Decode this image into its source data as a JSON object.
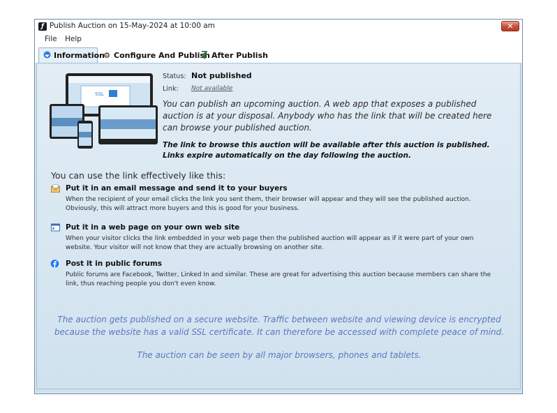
{
  "window": {
    "title": "Publish Auction on 15-May-2024 at 10:00 am",
    "close_glyph": "✕"
  },
  "menu": {
    "items": [
      "File",
      "Help"
    ]
  },
  "tabs": [
    {
      "label": "Information",
      "icon": "info-icon",
      "active": true
    },
    {
      "label": "Configure And Publish",
      "icon": "gear-icon",
      "active": false
    },
    {
      "label": "After Publish",
      "icon": "upload-arrow-icon",
      "active": false
    }
  ],
  "status": {
    "status_label": "Status:",
    "status_value": "Not published",
    "link_label": "Link:",
    "link_value": "Not available"
  },
  "intro": "You can publish an upcoming auction. A web app that exposes a published auction is at your disposal. Anybody who has the link that will be created here can browse your published auction.",
  "note": "The link to browse this auction will be available after this auction is published. Links expire automatically on the day following the auction.",
  "usage_heading": "You can use the link effectively like this:",
  "features": [
    {
      "icon": "email-envelope-icon",
      "title": "Put it in an email message and send it to your buyers",
      "description": "When the recipient of your email clicks the link you sent them, their browser will appear and they will see the published auction. Obviously, this will attract more buyers and this is good for your business."
    },
    {
      "icon": "web-page-icon",
      "title": "Put it in a web page on your own web site",
      "description": "When your visitor clicks the link embedded in your web page then the published auction will appear as if it were part of your own website. Your visitor will not know that they are actually browsing on another site."
    },
    {
      "icon": "facebook-icon",
      "title": "Post it in public forums",
      "description": "Public forums are Facebook, Twitter, Linked In and similar. These are great for advertising this auction because members can share the link, thus reaching people you don't even know."
    }
  ],
  "footer": {
    "security_note": "The auction gets published on a secure website. Traffic between website and viewing device is encrypted because the website has a valid SSL certificate. It can therefore be accessed with complete peace of mind.",
    "compatibility_note": "The auction can be seen by all major browsers, phones and tablets."
  },
  "device_image_text": "SSL",
  "colors": {
    "accent_blue": "#5b77bf",
    "content_bg": "#d6e6f2",
    "close_red": "#c7543f"
  }
}
